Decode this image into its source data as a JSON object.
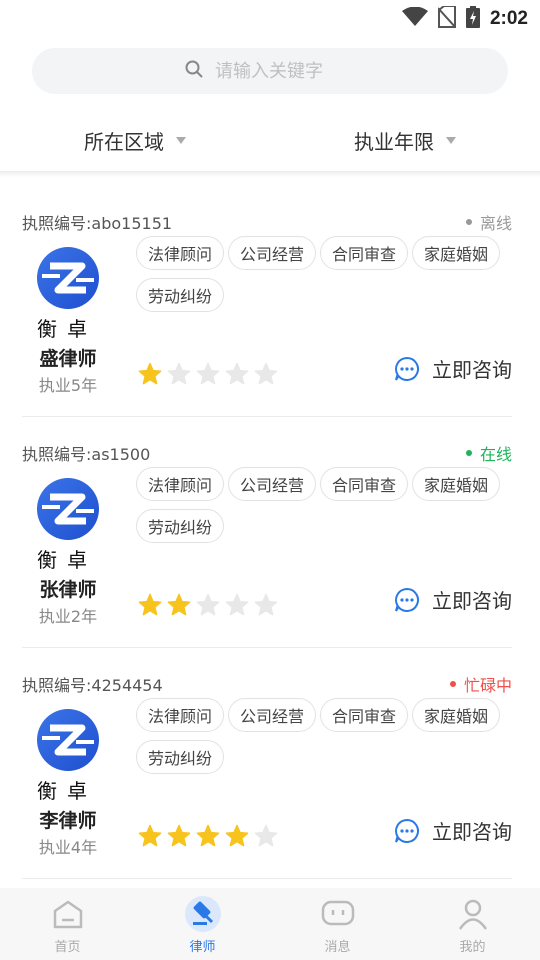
{
  "status_bar": {
    "time": "2:02",
    "wifi_icon": "wifi-icon",
    "no_sim_icon": "no-sim-icon",
    "battery_icon": "battery-charging-icon"
  },
  "search": {
    "placeholder": "请输入关键字",
    "icon": "search-icon"
  },
  "filters": [
    {
      "label": "所在区域"
    },
    {
      "label": "执业年限"
    }
  ],
  "lawyers": [
    {
      "license_label": "执照编号:",
      "license_no": "abo15151",
      "status": "离线",
      "status_color": "#999999",
      "logo_text": "衡卓",
      "name": "盛律师",
      "years": "执业5年",
      "tags": [
        "法律顾问",
        "公司经营",
        "合同审查",
        "家庭婚姻",
        "劳动纠纷"
      ],
      "rating": 1,
      "consult_label": "立即咨询"
    },
    {
      "license_label": "执照编号:",
      "license_no": "as1500",
      "status": "在线",
      "status_color": "#1fb35b",
      "logo_text": "衡卓",
      "name": "张律师",
      "years": "执业2年",
      "tags": [
        "法律顾问",
        "公司经营",
        "合同审查",
        "家庭婚姻",
        "劳动纠纷"
      ],
      "rating": 2,
      "consult_label": "立即咨询"
    },
    {
      "license_label": "执照编号:",
      "license_no": "4254454",
      "status": "忙碌中",
      "status_color": "#f0504a",
      "logo_text": "衡卓",
      "name": "李律师",
      "years": "执业4年",
      "tags": [
        "法律顾问",
        "公司经营",
        "合同审查",
        "家庭婚姻",
        "劳动纠纷"
      ],
      "rating": 4,
      "consult_label": "立即咨询"
    }
  ],
  "rating_max": 5,
  "colors": {
    "accent": "#2a79e6",
    "star_on": "#f7c31d",
    "star_off": "#e8e8e8"
  },
  "bottom_nav": [
    {
      "label": "首页",
      "icon": "home-icon",
      "active": false
    },
    {
      "label": "律师",
      "icon": "gavel-icon",
      "active": true
    },
    {
      "label": "消息",
      "icon": "message-icon",
      "active": false
    },
    {
      "label": "我的",
      "icon": "user-icon",
      "active": false
    }
  ]
}
